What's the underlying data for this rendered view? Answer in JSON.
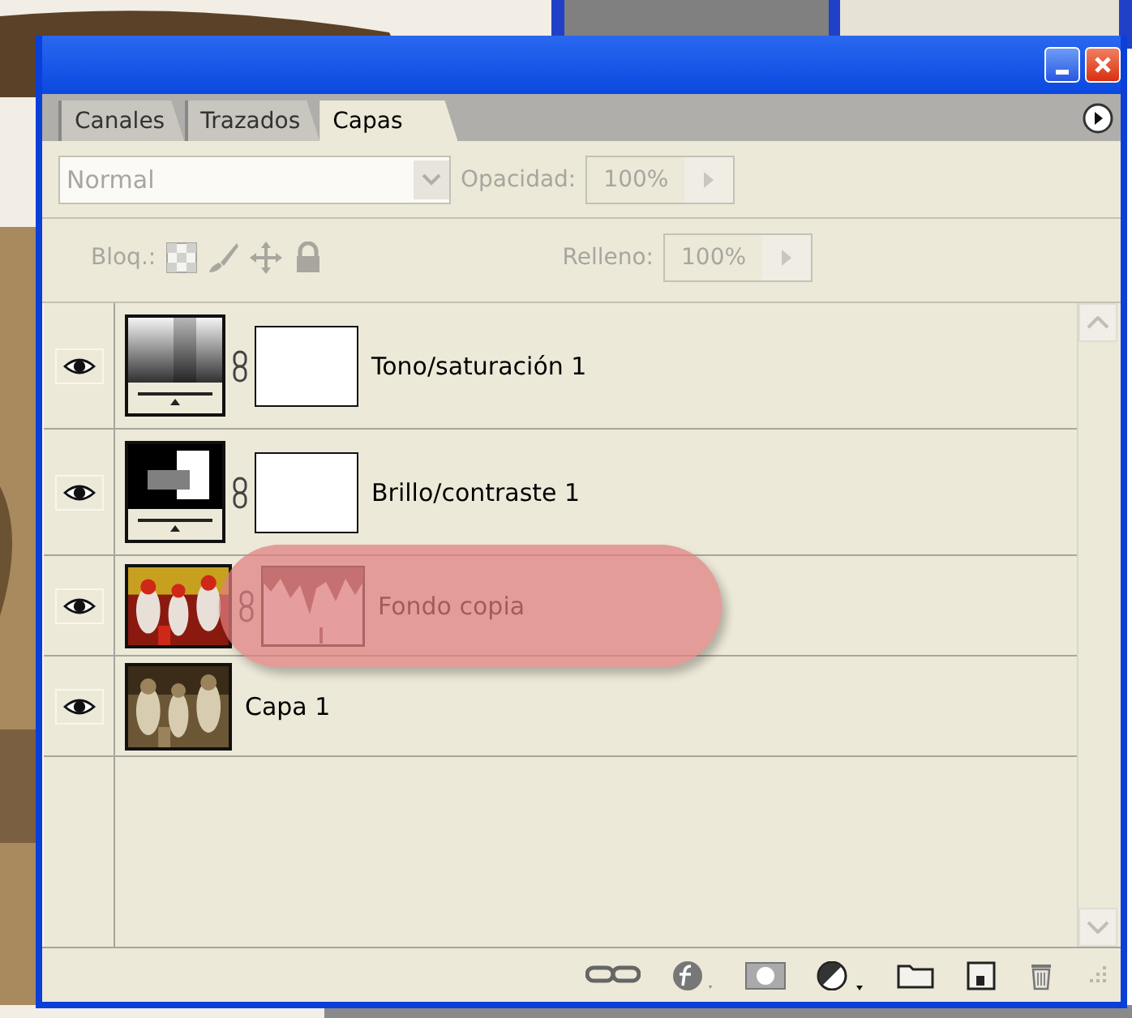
{
  "tabs": [
    {
      "label": "Canales",
      "selected": false
    },
    {
      "label": "Trazados",
      "selected": false
    },
    {
      "label": "Capas",
      "selected": true
    }
  ],
  "blend_mode": {
    "value": "Normal",
    "disabled": true
  },
  "opacity": {
    "label": "Opacidad:",
    "value": "100%",
    "disabled": true
  },
  "lock": {
    "label": "Bloq.:",
    "disabled": true
  },
  "fill": {
    "label": "Relleno:",
    "value": "100%",
    "disabled": true
  },
  "layers": [
    {
      "name": "Tono/saturación 1",
      "kind": "hue_saturation",
      "visible": true,
      "highlighted": false
    },
    {
      "name": "Brillo/contraste 1",
      "kind": "brightness_contrast",
      "visible": true,
      "highlighted": false
    },
    {
      "name": "Fondo copia",
      "kind": "masked_image",
      "visible": true,
      "highlighted": true
    },
    {
      "name": "Capa 1",
      "visible": true,
      "highlighted": false
    }
  ]
}
